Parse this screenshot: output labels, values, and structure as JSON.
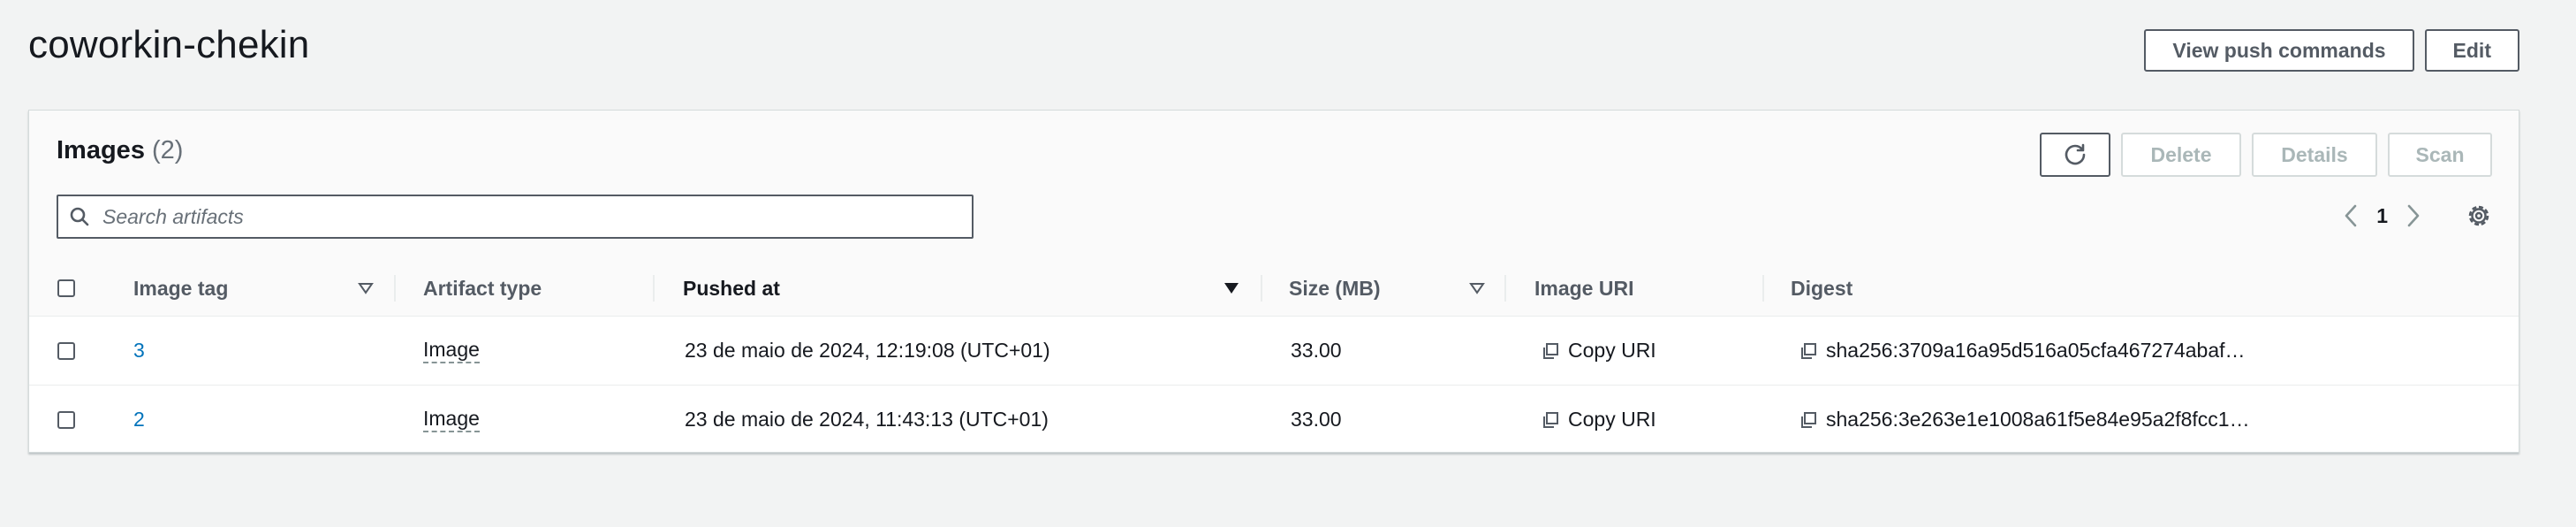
{
  "page": {
    "title": "coworkin-chekin"
  },
  "header_actions": {
    "view_push_commands": "View push commands",
    "edit": "Edit"
  },
  "panel": {
    "title": "Images",
    "count": "(2)",
    "actions": {
      "delete": "Delete",
      "details": "Details",
      "scan": "Scan"
    },
    "search": {
      "placeholder": "Search artifacts",
      "value": ""
    },
    "pagination": {
      "current_page": "1"
    }
  },
  "table": {
    "columns": {
      "image_tag": "Image tag",
      "artifact_type": "Artifact type",
      "pushed_at": "Pushed at",
      "size": "Size (MB)",
      "image_uri": "Image URI",
      "digest": "Digest"
    },
    "rows": [
      {
        "image_tag": "3",
        "artifact_type": "Image",
        "pushed_at": "23 de maio de 2024, 12:19:08 (UTC+01)",
        "size": "33.00",
        "image_uri": "Copy URI",
        "digest": "sha256:3709a16a95d516a05cfa467274abaf…"
      },
      {
        "image_tag": "2",
        "artifact_type": "Image",
        "pushed_at": "23 de maio de 2024, 11:43:13 (UTC+01)",
        "size": "33.00",
        "image_uri": "Copy URI",
        "digest": "sha256:3e263e1e1008a61f5e84e95a2f8fcc1…"
      }
    ]
  },
  "colors": {
    "link": "#0073bb",
    "background": "#f2f3f3",
    "button_border": "#545b64"
  },
  "icons": [
    "refresh-icon",
    "search-icon",
    "chevron-left-icon",
    "chevron-right-icon",
    "settings-icon",
    "sort-icon",
    "copy-icon"
  ]
}
